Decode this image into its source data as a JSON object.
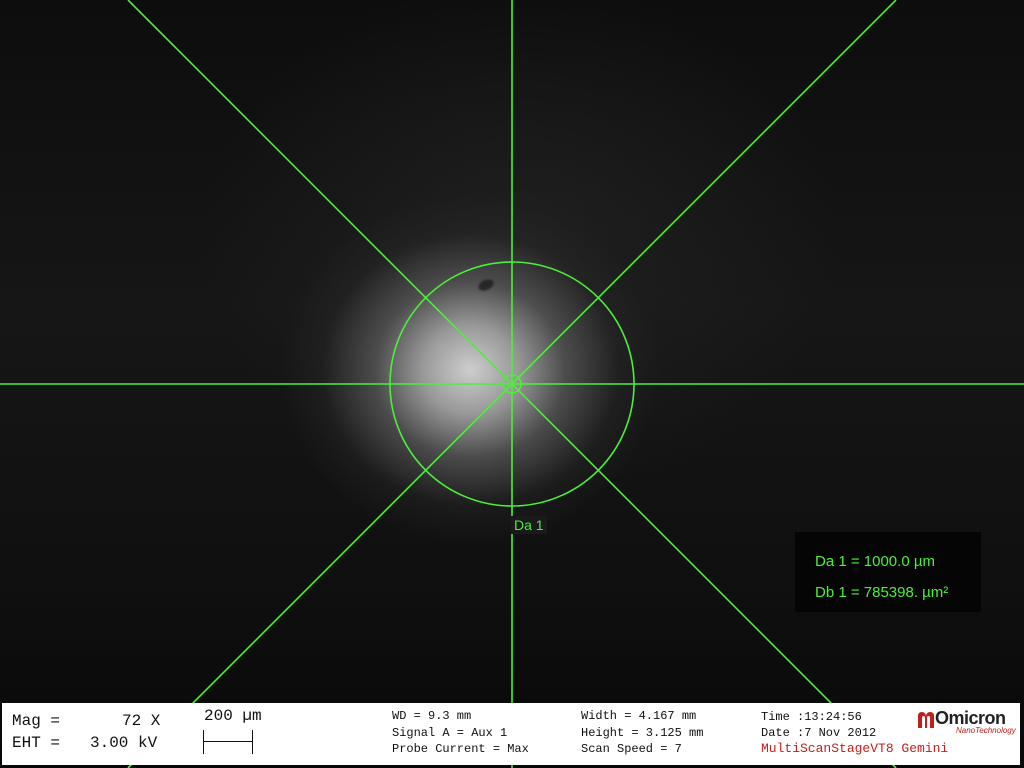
{
  "overlay": {
    "measurement_label": "Da 1",
    "readouts": [
      "Da 1 = 1000.0 µm",
      "Db 1 = 785398. µm²"
    ],
    "color": "#4cef3a"
  },
  "databar": {
    "mag_label": "Mag =",
    "mag_value": "72 X",
    "eht_label": "EHT =",
    "eht_value": "3.00 kV",
    "scale_label": "200 µm",
    "wd": "WD =  9.3 mm",
    "signal": "Signal A = Aux 1",
    "probe_current": "Probe Current = Max",
    "width": "Width = 4.167 mm",
    "height": "Height = 3.125 mm",
    "scan_speed": "Scan Speed = 7",
    "time": "Time :13:24:56",
    "date": "Date :7 Nov 2012",
    "stage": "MultiScanStageVT8  Gemini",
    "logo_text": "Omicron",
    "logo_subtext": "NanoTechnology",
    "logo_icon": "omicron-logo-icon",
    "brand_color": "#c0201c"
  }
}
